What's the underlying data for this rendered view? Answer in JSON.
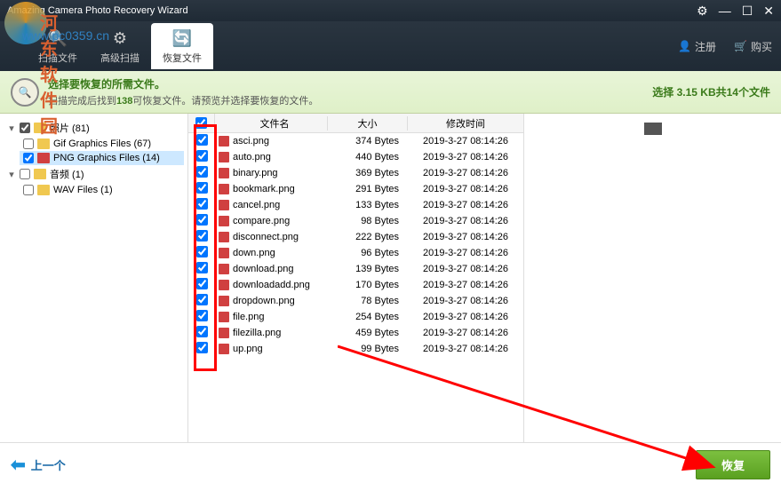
{
  "window": {
    "title": "Amazing Camera Photo Recovery Wizard"
  },
  "watermark": {
    "text1": "河东软件园",
    "text2": "www.pc0359.cn"
  },
  "tabs": {
    "scan": "扫描文件",
    "advanced": "高级扫描",
    "recover": "恢复文件"
  },
  "toolbar": {
    "register": "注册",
    "buy": "购买"
  },
  "info": {
    "title": "选择要恢复的所需文件。",
    "sub_pre": "扫描完成后找到",
    "sub_count": "138",
    "sub_post": "可恢复文件。请预览并选择要恢复的文件。",
    "right": "选择 3.15 KB共14个文件"
  },
  "tree": {
    "photos": {
      "label": "照片 (81)"
    },
    "gif": {
      "label": "Gif Graphics Files (67)"
    },
    "png": {
      "label": "PNG Graphics Files (14)"
    },
    "audio": {
      "label": "音频 (1)"
    },
    "wav": {
      "label": "WAV Files (1)"
    }
  },
  "headers": {
    "name": "文件名",
    "size": "大小",
    "date": "修改时间"
  },
  "files": [
    {
      "name": "asci.png",
      "size": "374 Bytes",
      "date": "2019-3-27 08:14:26"
    },
    {
      "name": "auto.png",
      "size": "440 Bytes",
      "date": "2019-3-27 08:14:26"
    },
    {
      "name": "binary.png",
      "size": "369 Bytes",
      "date": "2019-3-27 08:14:26"
    },
    {
      "name": "bookmark.png",
      "size": "291 Bytes",
      "date": "2019-3-27 08:14:26"
    },
    {
      "name": "cancel.png",
      "size": "133 Bytes",
      "date": "2019-3-27 08:14:26"
    },
    {
      "name": "compare.png",
      "size": "98 Bytes",
      "date": "2019-3-27 08:14:26"
    },
    {
      "name": "disconnect.png",
      "size": "222 Bytes",
      "date": "2019-3-27 08:14:26"
    },
    {
      "name": "down.png",
      "size": "96 Bytes",
      "date": "2019-3-27 08:14:26"
    },
    {
      "name": "download.png",
      "size": "139 Bytes",
      "date": "2019-3-27 08:14:26"
    },
    {
      "name": "downloadadd.png",
      "size": "170 Bytes",
      "date": "2019-3-27 08:14:26"
    },
    {
      "name": "dropdown.png",
      "size": "78 Bytes",
      "date": "2019-3-27 08:14:26"
    },
    {
      "name": "file.png",
      "size": "254 Bytes",
      "date": "2019-3-27 08:14:26"
    },
    {
      "name": "filezilla.png",
      "size": "459 Bytes",
      "date": "2019-3-27 08:14:26"
    },
    {
      "name": "up.png",
      "size": "99 Bytes",
      "date": "2019-3-27 08:14:26"
    }
  ],
  "footer": {
    "prev": "上一个",
    "recover": "恢复"
  }
}
